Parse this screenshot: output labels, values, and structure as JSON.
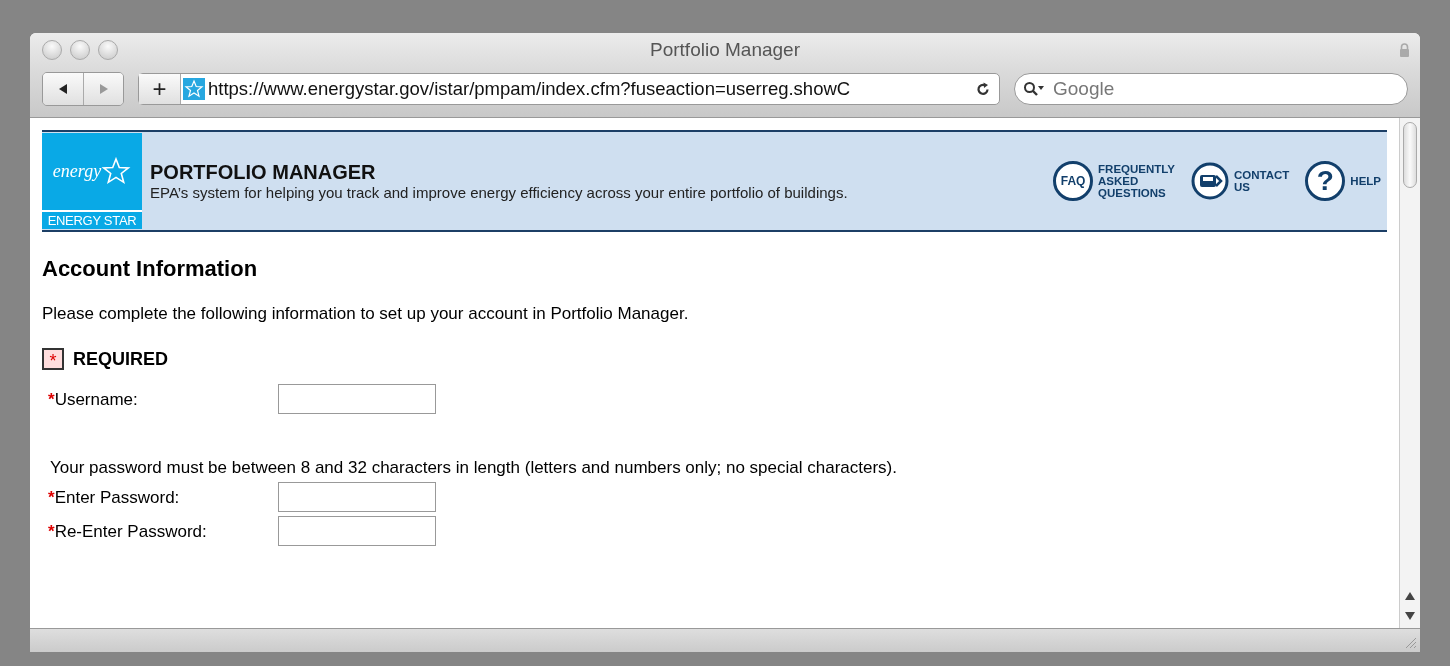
{
  "window": {
    "title": "Portfolio Manager"
  },
  "toolbar": {
    "add": "+",
    "url": "https://www.energystar.gov/istar/pmpam/index.cfm?fuseaction=userreg.showC",
    "search": {
      "placeholder": "Google"
    }
  },
  "banner": {
    "logo_script": "energy",
    "logo_text": "ENERGY STAR",
    "title": "PORTFOLIO MANAGER",
    "subtitle": "EPA’s system for helping you track and improve energy efficiency across your entire portfolio of buildings.",
    "links": [
      {
        "kind": "faq",
        "icon_text": "FAQ",
        "lines": [
          "FREQUENTLY",
          "ASKED",
          "QUESTIONS"
        ]
      },
      {
        "kind": "contact",
        "lines": [
          "CONTACT",
          "US"
        ]
      },
      {
        "kind": "help",
        "icon_text": "?",
        "lines": [
          "HELP"
        ]
      }
    ]
  },
  "form": {
    "heading": "Account Information",
    "intro": "Please complete the following information to set up your account in Portfolio Manager.",
    "required_mark": "*",
    "required_label": "REQUIRED",
    "items": [
      {
        "kind": "field",
        "mark": "*",
        "label": "Username:"
      },
      {
        "kind": "note",
        "text": "Your password must be between 8 and 32 characters in length (letters and numbers only; no special characters)."
      },
      {
        "kind": "field",
        "mark": "*",
        "label": "Enter Password:"
      },
      {
        "kind": "field",
        "mark": "*",
        "label": "Re-Enter Password:"
      }
    ]
  }
}
